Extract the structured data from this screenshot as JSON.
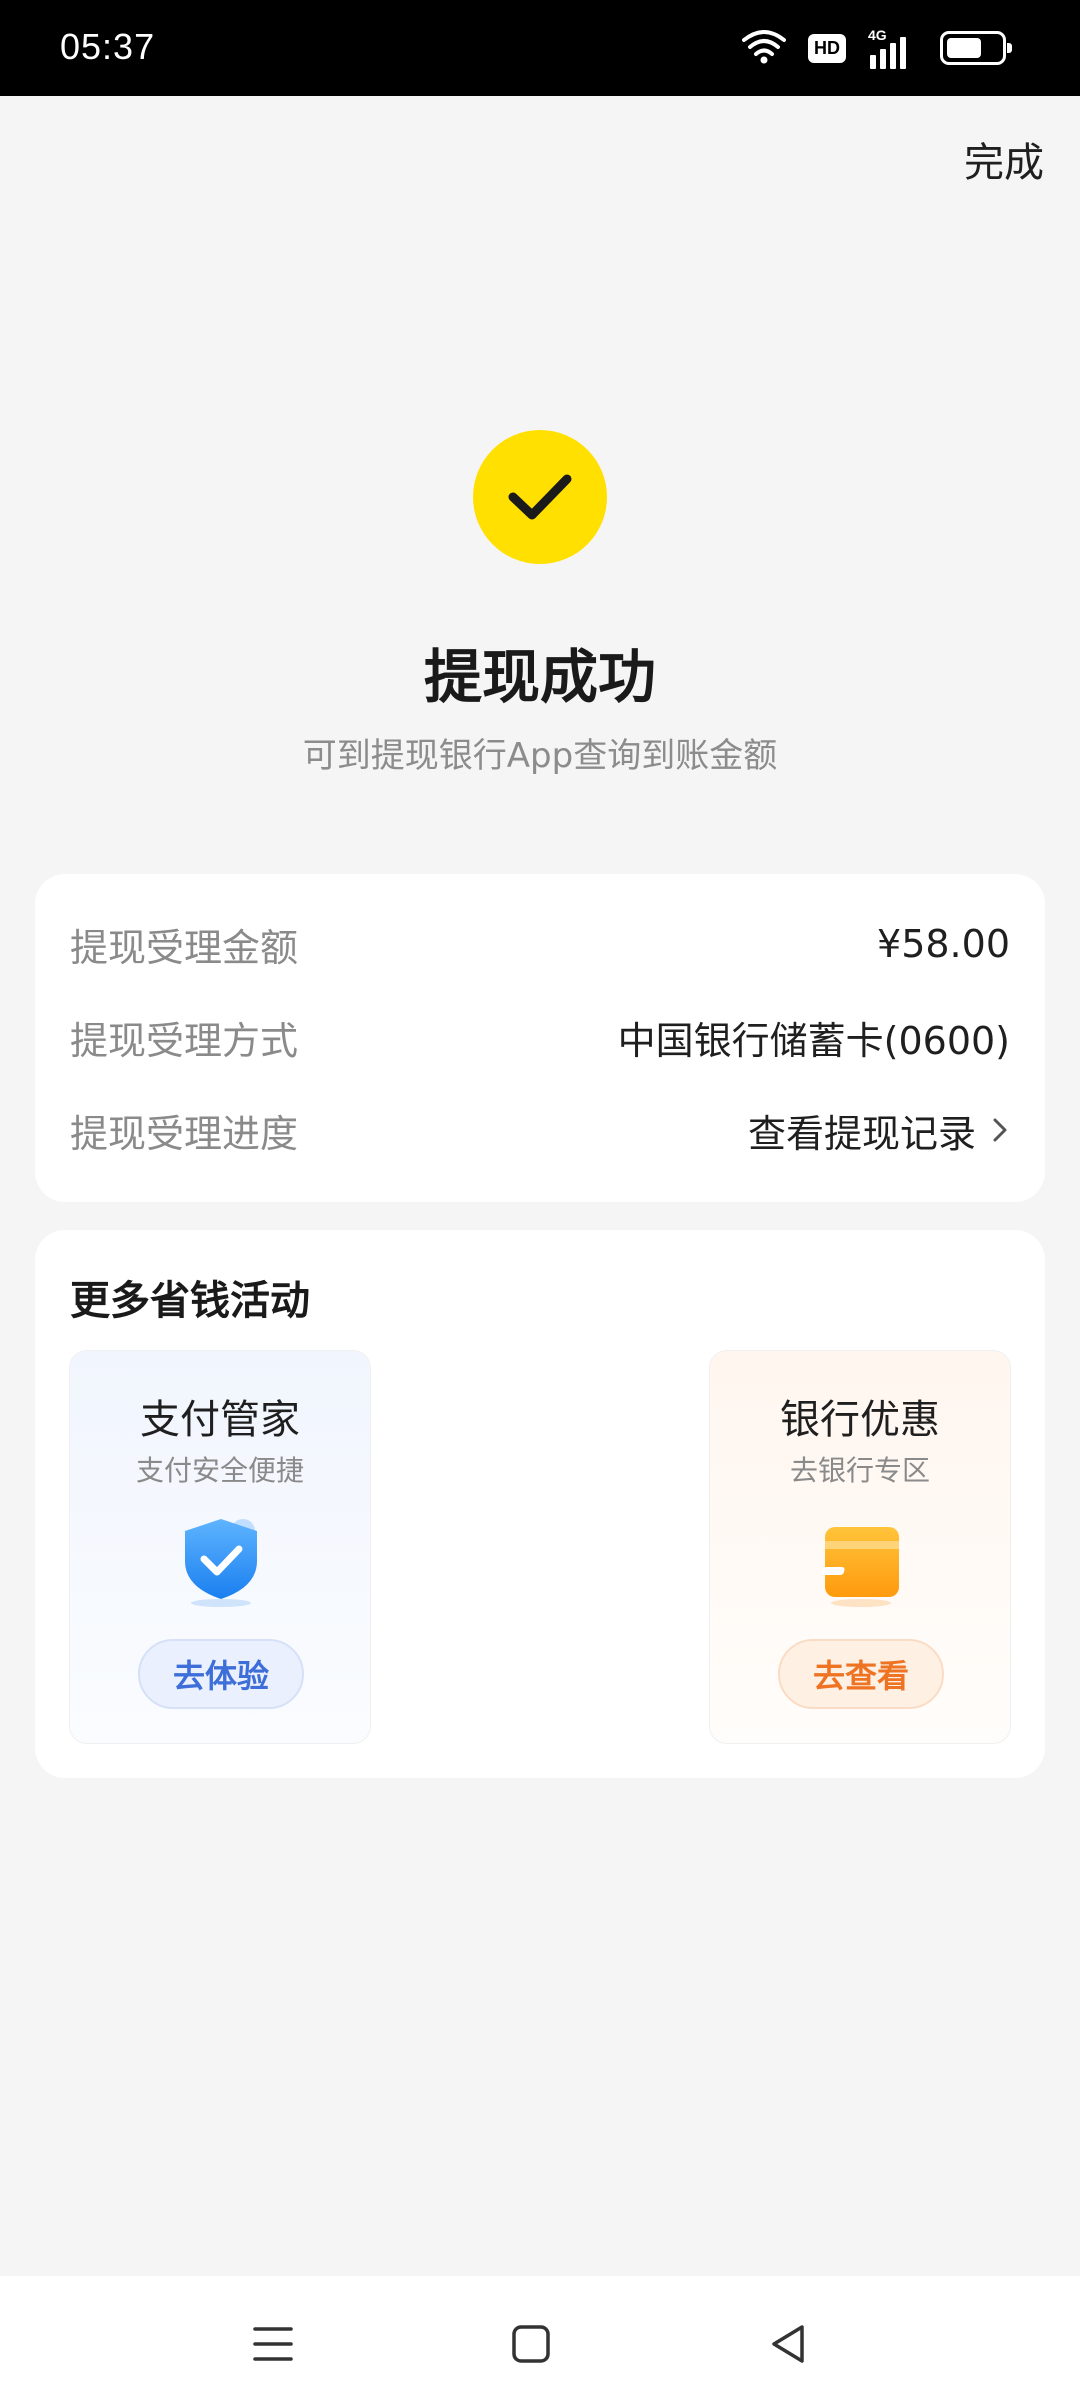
{
  "status_bar": {
    "time": "05:37",
    "hd_badge": "HD",
    "network": "4G",
    "icons": [
      "wifi-icon",
      "hd-icon",
      "signal-4g-icon",
      "battery-icon"
    ]
  },
  "header": {
    "done_label": "完成"
  },
  "result": {
    "icon": "check-icon",
    "title": "提现成功",
    "subtitle": "可到提现银行App查询到账金额",
    "accent_color": "#ffe000"
  },
  "details": {
    "rows": [
      {
        "label": "提现受理金额",
        "value": "¥58.00"
      },
      {
        "label": "提现受理方式",
        "value": "中国银行储蓄卡(0600)"
      },
      {
        "label": "提现受理进度",
        "value": "查看提现记录"
      }
    ]
  },
  "promotions": {
    "title": "更多省钱活动",
    "items": [
      {
        "name": "支付管家",
        "desc": "支付安全便捷",
        "icon": "shield-check-icon",
        "button": "去体验",
        "button_color": "#3e6fd9"
      },
      {
        "name": "银行优惠",
        "desc": "去银行专区",
        "icon": "bank-card-icon",
        "button": "去查看",
        "button_color": "#ee7424"
      }
    ]
  },
  "nav_bar": {
    "icons": [
      "menu-icon",
      "home-icon",
      "back-icon"
    ]
  }
}
